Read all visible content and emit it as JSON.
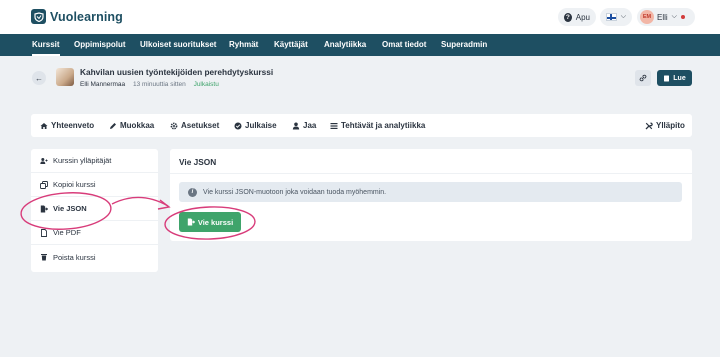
{
  "brand": {
    "name": "Vuolearning"
  },
  "topbar": {
    "help_label": "Apu",
    "language_flag": "fi",
    "user_initials": "EM",
    "user_name": "Elli"
  },
  "nav": {
    "items": [
      {
        "label": "Kurssit",
        "active": true
      },
      {
        "label": "Oppimispolut"
      },
      {
        "label": "Ulkoiset suoritukset"
      },
      {
        "label": "Ryhmät"
      },
      {
        "label": "Käyttäjät"
      },
      {
        "label": "Analytiikka"
      },
      {
        "label": "Omat tiedot"
      },
      {
        "label": "Superadmin"
      }
    ]
  },
  "course": {
    "title": "Kahvilan uusien työntekijöiden perehdytyskurssi",
    "author": "Elli Mannermaa",
    "updated": "13 minuuttia sitten",
    "status": "Julkaistu",
    "read_button": "Lue"
  },
  "tabs": {
    "items": [
      {
        "label": "Yhteenveto",
        "icon": "home-icon"
      },
      {
        "label": "Muokkaa",
        "icon": "pencil-icon"
      },
      {
        "label": "Asetukset",
        "icon": "gear-icon"
      },
      {
        "label": "Julkaise",
        "icon": "check-circle-icon"
      },
      {
        "label": "Jaa",
        "icon": "user-icon"
      },
      {
        "label": "Tehtävät ja analytiikka",
        "icon": "tasks-icon"
      }
    ],
    "admin_label": "Ylläpito"
  },
  "sidemenu": {
    "items": [
      {
        "label": "Kurssin ylläpitäjät",
        "icon": "users-icon"
      },
      {
        "label": "Kopioi kurssi",
        "icon": "copy-icon"
      },
      {
        "label": "Vie JSON",
        "icon": "export-icon",
        "active": true
      },
      {
        "label": "Vie PDF",
        "icon": "file-icon"
      },
      {
        "label": "Poista kurssi",
        "icon": "trash-icon"
      }
    ]
  },
  "panel": {
    "title": "Vie JSON",
    "info": "Vie kurssi JSON-muotoon joka voidaan tuoda myöhemmin.",
    "export_button": "Vie kurssi"
  },
  "colors": {
    "brand": "#1e4f62",
    "success": "#3fa46b",
    "annotation": "#d83c7a",
    "background": "#eef1f4"
  }
}
